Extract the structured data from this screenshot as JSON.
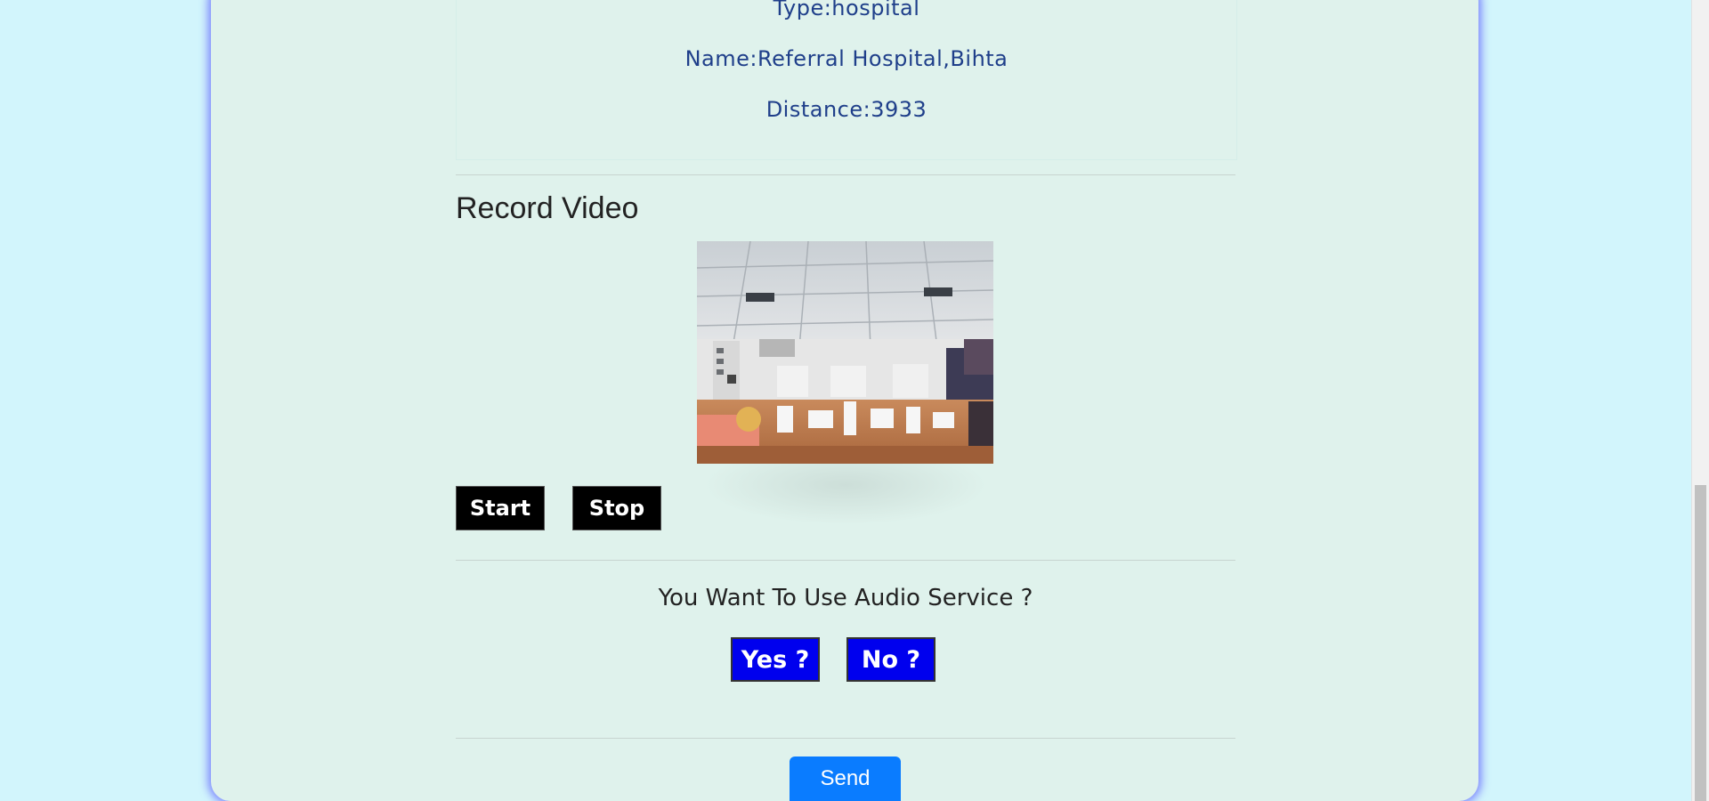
{
  "facility": {
    "type_text": "Type:hospital",
    "name_text": "Name:Referral Hospital,Bihta",
    "distance_text": "Distance:3933"
  },
  "record_video": {
    "title": "Record Video",
    "start_label": "Start",
    "stop_label": "Stop"
  },
  "audio_service": {
    "question": "You Want To Use Audio Service ?",
    "yes_label": "Yes ?",
    "no_label": "No ?"
  },
  "send_label": "Send",
  "colors": {
    "page_background": "#d2f5fc",
    "card_background": "#dff2ec",
    "info_text": "#1f3f8a",
    "audio_button": "#0000ee",
    "send_button": "#0a7cff"
  }
}
